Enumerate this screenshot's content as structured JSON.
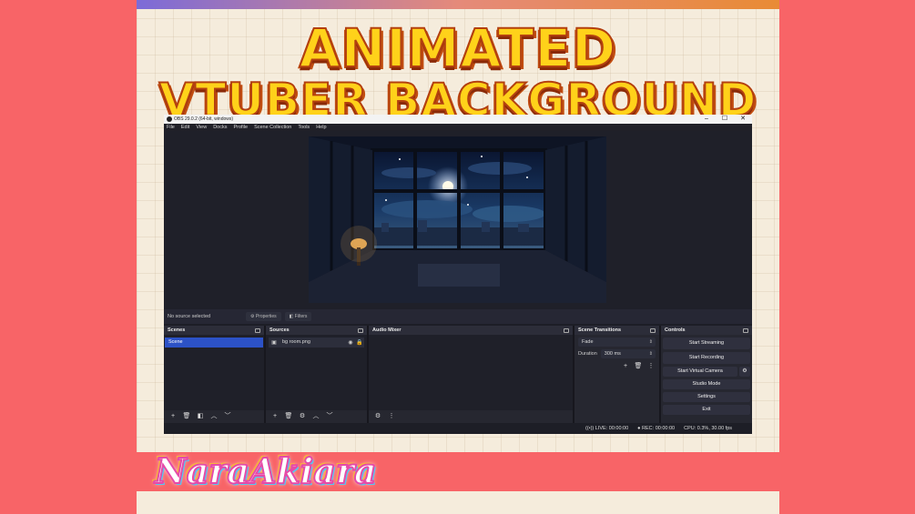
{
  "banner": {
    "line1": "ANIMATED",
    "line2": "VTUBER BACKGROUND"
  },
  "window": {
    "title": "OBS 29.0.2 (64-bit, windows)",
    "controls": {
      "minimize": "–",
      "maximize": "☐",
      "close": "✕"
    }
  },
  "menu": [
    "File",
    "Edit",
    "View",
    "Docks",
    "Profile",
    "Scene Collection",
    "Tools",
    "Help"
  ],
  "preview": {
    "watermark": "NaraAkiara"
  },
  "source_bar": {
    "status": "No source selected",
    "properties": "Properties",
    "filters": "Filters"
  },
  "docks": {
    "scenes": {
      "title": "Scenes",
      "items": [
        "Scene"
      ]
    },
    "sources": {
      "title": "Sources",
      "items": [
        "bg room.png"
      ]
    },
    "audio": {
      "title": "Audio Mixer"
    },
    "transitions": {
      "title": "Scene Transitions",
      "type": "Fade",
      "duration_label": "Duration",
      "duration_value": "300 ms"
    },
    "controls": {
      "title": "Controls",
      "start_streaming": "Start Streaming",
      "start_recording": "Start Recording",
      "start_virtual_camera": "Start Virtual Camera",
      "studio_mode": "Studio Mode",
      "settings": "Settings",
      "exit": "Exit"
    }
  },
  "status": {
    "live": "LIVE: 00:00:00",
    "rec": "REC: 00:00:00",
    "cpu": "CPU: 0.3%, 30.00 fps"
  },
  "logo": "NaraAkiara",
  "colors": {
    "accent": "#2c52c7",
    "background": "#f86467",
    "card": "#f5ecdc"
  },
  "icons": [
    "plus-icon",
    "trash-icon",
    "filter-icon",
    "up-icon",
    "down-icon",
    "gear-icon",
    "eye-icon",
    "lock-icon",
    "more-icon"
  ]
}
